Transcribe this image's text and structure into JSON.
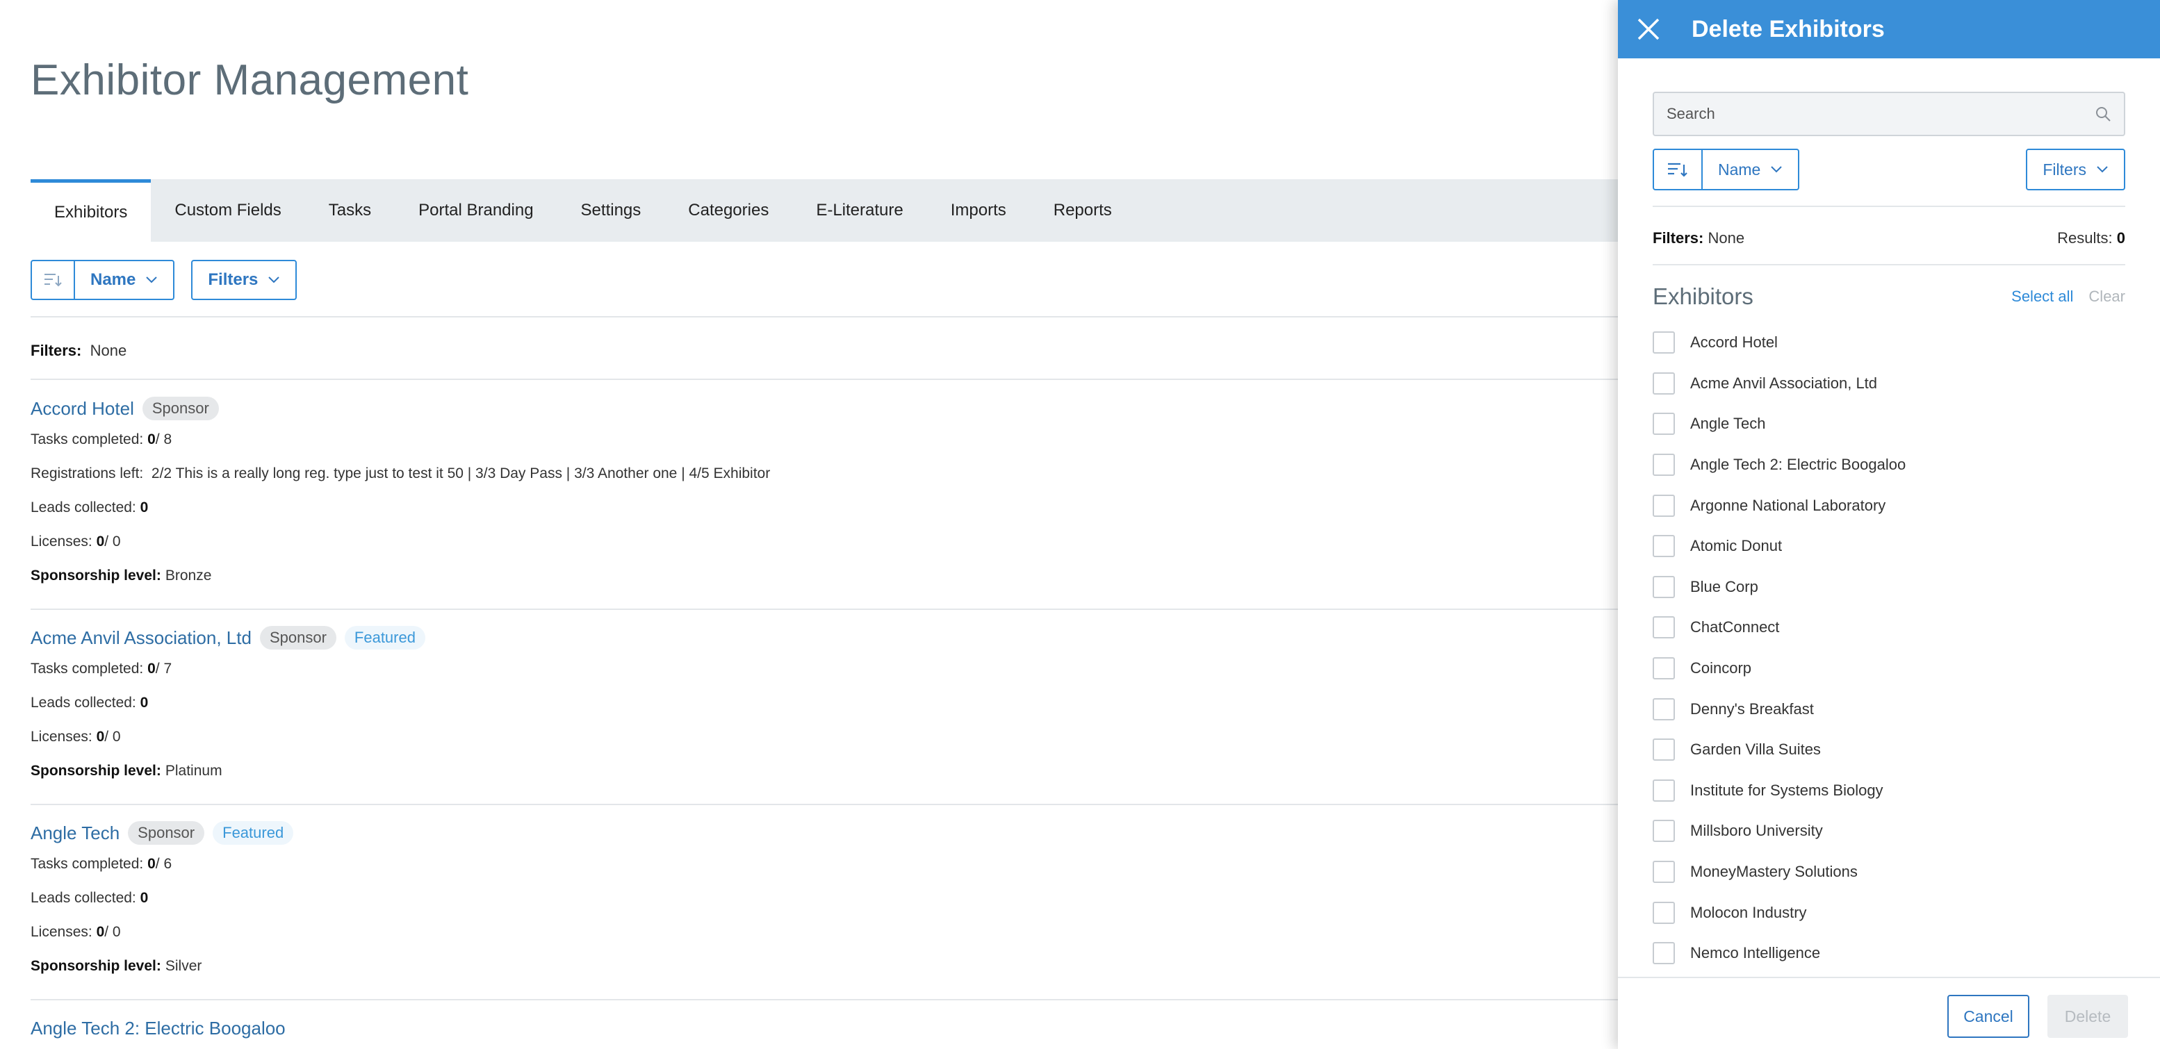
{
  "page": {
    "title": "Exhibitor Management"
  },
  "tabs": [
    {
      "label": "Exhibitors",
      "active": true
    },
    {
      "label": "Custom Fields"
    },
    {
      "label": "Tasks"
    },
    {
      "label": "Portal Branding"
    },
    {
      "label": "Settings"
    },
    {
      "label": "Categories"
    },
    {
      "label": "E-Literature"
    },
    {
      "label": "Imports"
    },
    {
      "label": "Reports"
    }
  ],
  "toolbar": {
    "sort_label": "Name",
    "filters_label": "Filters"
  },
  "filters": {
    "label": "Filters:",
    "value": "None"
  },
  "exhibitors": [
    {
      "name": "Accord Hotel",
      "badges": [
        {
          "text": "Sponsor",
          "kind": "sponsor"
        }
      ],
      "tasks": {
        "label": "Tasks completed:",
        "done": "0",
        "total": " / 8"
      },
      "registrations": {
        "label": "Registrations left:",
        "text": "2/2 This is a really long reg. type just to test it 50 | 3/3 Day Pass | 3/3 Another one | 4/5 Exhibitor"
      },
      "leads": {
        "label": "Leads collected:",
        "value": "0"
      },
      "licenses": {
        "label": "Licenses:",
        "used": "0",
        "total": " / 0"
      },
      "sponsorship": {
        "label": "Sponsorship level:",
        "value": "Bronze"
      }
    },
    {
      "name": "Acme Anvil Association, Ltd",
      "badges": [
        {
          "text": "Sponsor",
          "kind": "sponsor"
        },
        {
          "text": "Featured",
          "kind": "featured"
        }
      ],
      "tasks": {
        "label": "Tasks completed:",
        "done": "0",
        "total": " / 7"
      },
      "leads": {
        "label": "Leads collected:",
        "value": "0"
      },
      "licenses": {
        "label": "Licenses:",
        "used": "0",
        "total": " / 0"
      },
      "sponsorship": {
        "label": "Sponsorship level:",
        "value": "Platinum"
      }
    },
    {
      "name": "Angle Tech",
      "badges": [
        {
          "text": "Sponsor",
          "kind": "sponsor"
        },
        {
          "text": "Featured",
          "kind": "featured"
        }
      ],
      "tasks": {
        "label": "Tasks completed:",
        "done": "0",
        "total": " / 6"
      },
      "leads": {
        "label": "Leads collected:",
        "value": "0"
      },
      "licenses": {
        "label": "Licenses:",
        "used": "0",
        "total": " / 0"
      },
      "sponsorship": {
        "label": "Sponsorship level:",
        "value": "Silver"
      }
    },
    {
      "name": "Angle Tech 2: Electric Boogaloo",
      "badges": []
    }
  ],
  "panel": {
    "title": "Delete Exhibitors",
    "search_placeholder": "Search",
    "sort_label": "Name",
    "filters_label": "Filters",
    "filters_text_label": "Filters:",
    "filters_value": "None",
    "results_label": "Results:",
    "results_value": "0",
    "list_title": "Exhibitors",
    "select_all": "Select all",
    "clear": "Clear",
    "items": [
      "Accord Hotel",
      "Acme Anvil Association, Ltd",
      "Angle Tech",
      "Angle Tech 2: Electric Boogaloo",
      "Argonne National Laboratory",
      "Atomic Donut",
      "Blue Corp",
      "ChatConnect",
      "Coincorp",
      "Denny's Breakfast",
      "Garden Villa Suites",
      "Institute for Systems Biology",
      "Millsboro University",
      "MoneyMastery Solutions",
      "Molocon Industry",
      "Nemco Intelligence"
    ],
    "cancel_label": "Cancel",
    "delete_label": "Delete"
  },
  "colors": {
    "accent": "#2e8ad8",
    "header_blue": "#3a8fd8",
    "link": "#2e6da4",
    "title_gray": "#5d6d78"
  },
  "icons": {
    "close": "close-icon",
    "sort": "sort-icon",
    "chevron": "chevron-down-icon",
    "search": "search-icon"
  }
}
